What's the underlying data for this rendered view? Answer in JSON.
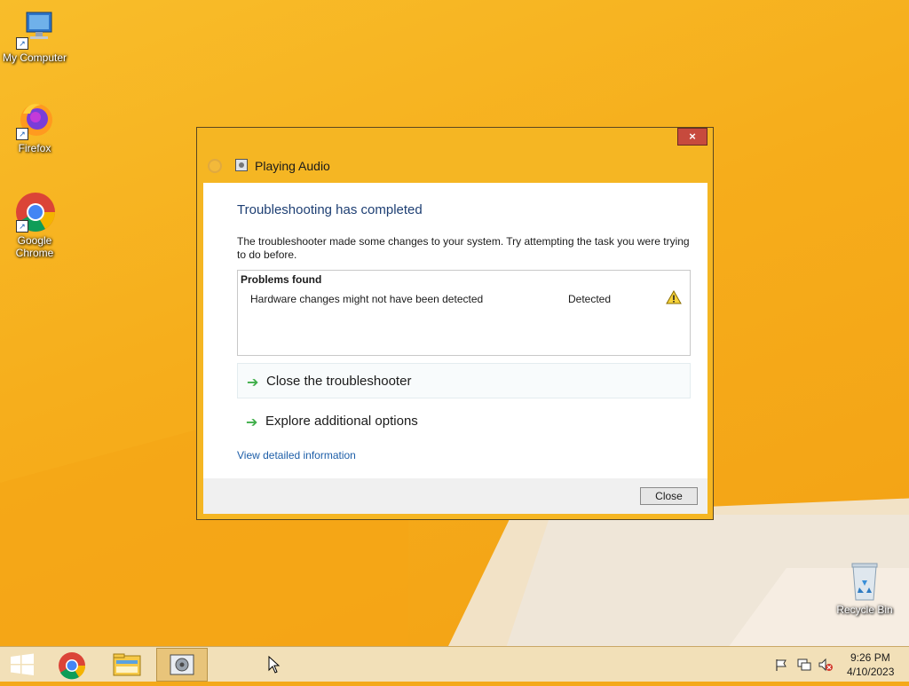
{
  "desktop_icons": [
    {
      "label": "My Computer",
      "icon": "computer-icon"
    },
    {
      "label": "Firefox",
      "icon": "firefox-icon"
    },
    {
      "label": "Google Chrome",
      "icon": "chrome-icon"
    },
    {
      "label": "Recycle Bin",
      "icon": "recycle-bin-icon"
    }
  ],
  "dialog": {
    "title": "Playing Audio",
    "close_symbol": "×",
    "heading": "Troubleshooting has completed",
    "description": "The troubleshooter made some changes to your system. Try attempting the task you were trying to do before.",
    "problems_title": "Problems found",
    "problems": [
      {
        "name": "Hardware changes might not have been detected",
        "status": "Detected",
        "icon": "warning-icon"
      }
    ],
    "actions": [
      {
        "label": "Close the troubleshooter",
        "icon": "green-arrow-icon"
      },
      {
        "label": "Explore additional options",
        "icon": "green-arrow-icon"
      }
    ],
    "arrow_glyph": "➔",
    "details_link": "View detailed information",
    "close_button": "Close"
  },
  "taskbar": {
    "items": [
      "start-icon",
      "chrome-icon",
      "file-explorer-icon",
      "troubleshooter-icon"
    ],
    "clock_time": "9:26 PM",
    "clock_date": "4/10/2023"
  }
}
